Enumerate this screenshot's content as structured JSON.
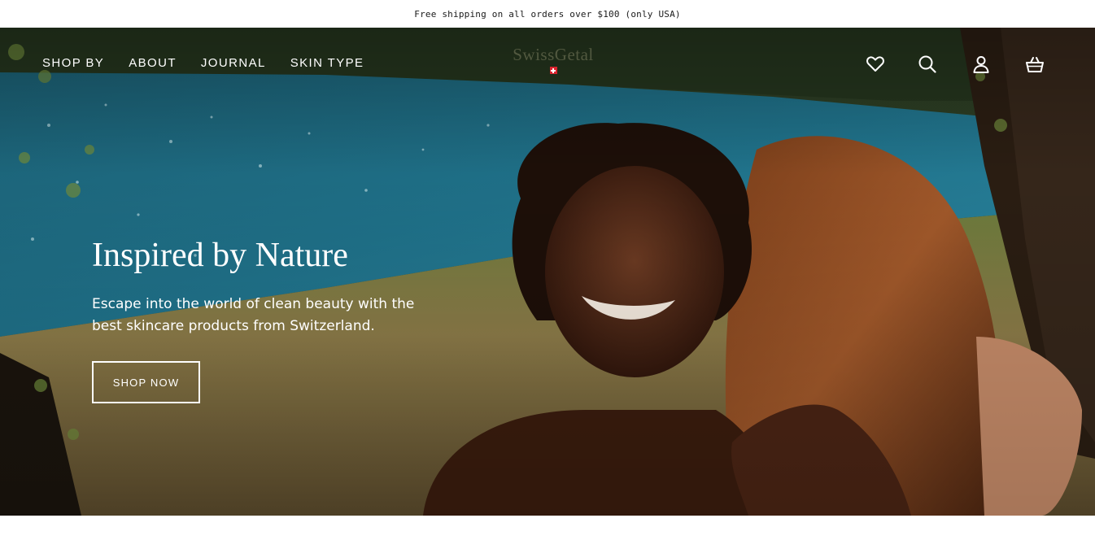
{
  "announcement": {
    "text": "Free shipping on all orders over $100 (only USA)"
  },
  "header": {
    "nav": [
      {
        "label": "SHOP BY"
      },
      {
        "label": "ABOUT"
      },
      {
        "label": "JOURNAL"
      },
      {
        "label": "SKIN TYPE"
      }
    ],
    "logo": {
      "text": "SwissGetal",
      "flag_color": "#d9232e"
    },
    "icons": [
      "heart-icon",
      "search-icon",
      "account-icon",
      "cart-icon"
    ]
  },
  "hero": {
    "title": "Inspired by Nature",
    "subtitle": "Escape into the world of clean beauty with the best skincare products from Switzerland.",
    "button_label": "SHOP NOW",
    "image_description_icon": "hero-photo"
  },
  "colors": {
    "text_on_hero": "#ffffff",
    "lake": "#1f6f86",
    "foliage": "#3d5226",
    "ground": "#8a7748"
  }
}
